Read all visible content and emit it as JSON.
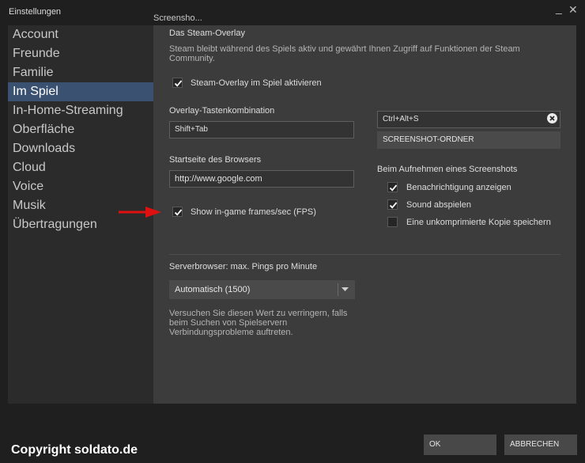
{
  "window": {
    "title": "Einstellungen",
    "minimize_icon": "minimize-icon",
    "close_icon": "close-icon"
  },
  "sidebar": {
    "items": [
      {
        "label": "Account"
      },
      {
        "label": "Freunde"
      },
      {
        "label": "Familie"
      },
      {
        "label": "Im Spiel",
        "active": true
      },
      {
        "label": "In-Home-Streaming"
      },
      {
        "label": "Oberfläche"
      },
      {
        "label": "Downloads"
      },
      {
        "label": "Cloud"
      },
      {
        "label": "Voice"
      },
      {
        "label": "Musik"
      },
      {
        "label": "Übertragungen"
      }
    ]
  },
  "tab_caption": "Screensho...",
  "overlay": {
    "heading": "Das Steam-Overlay",
    "description": "Steam bleibt während des Spiels aktiv und gewährt Ihnen Zugriff auf Funktionen der Steam Community.",
    "enable_label": "Steam-Overlay im Spiel aktivieren",
    "enable_checked": true,
    "hotkey_label": "Overlay-Tastenkombination",
    "hotkey_value": "Shift+Tab",
    "homepage_label": "Startseite des Browsers",
    "homepage_value": "http://www.google.com",
    "fps_label": "Show in-game frames/sec (FPS)",
    "fps_checked": true
  },
  "screenshot": {
    "hotkey_value": "Ctrl+Alt+S",
    "folder_button": "SCREENSHOT-ORDNER",
    "capture_heading": "Beim Aufnehmen eines Screenshots",
    "options": [
      {
        "label": "Benachrichtigung anzeigen",
        "checked": true
      },
      {
        "label": "Sound abspielen",
        "checked": true
      },
      {
        "label": "Eine unkomprimierte Kopie speichern",
        "checked": false
      }
    ]
  },
  "server_browser": {
    "label": "Serverbrowser: max. Pings pro Minute",
    "selected": "Automatisch (1500)",
    "hint": "Versuchen Sie diesen Wert zu verringern, falls beim Suchen von Spielservern Verbindungsprobleme auftreten."
  },
  "footer": {
    "ok": "OK",
    "cancel": "ABBRECHEN"
  },
  "copyright": "Copyright soldato.de",
  "colors": {
    "accent": "#3a5172",
    "arrow": "#e01010",
    "panel": "#3c3c3c",
    "sidebar": "#2b2b2b"
  }
}
